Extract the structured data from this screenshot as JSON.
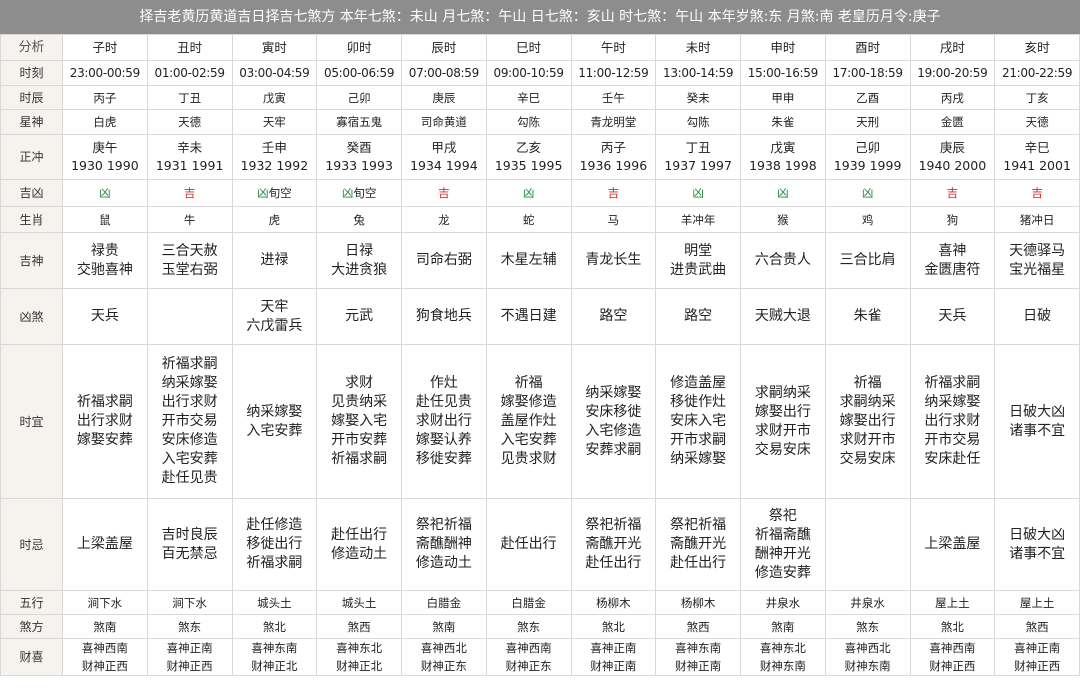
{
  "title": "择吉老黄历黄道吉日择吉七煞方   本年七煞：未山   月七煞：午山   日七煞：亥山   时七煞：午山   本年岁煞:东   月煞:南    老皇历月令:庚子",
  "colors": {
    "title_bg": "#8d8d8d",
    "label_bg": "#f6f2ee",
    "ji": "#d42a2a",
    "xiong": "#1f8a3a"
  },
  "rows": [
    {
      "key": "fenxi",
      "label": "分析",
      "h": 26,
      "cls": "",
      "cells": [
        "子时",
        "丑时",
        "寅时",
        "卯时",
        "辰时",
        "巳时",
        "午时",
        "未时",
        "申时",
        "酉时",
        "戌时",
        "亥时"
      ]
    },
    {
      "key": "shike",
      "label": "时刻",
      "h": 25,
      "cls": "t",
      "cells": [
        "23:00-00:59",
        "01:00-02:59",
        "03:00-04:59",
        "05:00-06:59",
        "07:00-08:59",
        "09:00-10:59",
        "11:00-12:59",
        "13:00-14:59",
        "15:00-16:59",
        "17:00-18:59",
        "19:00-20:59",
        "21:00-22:59"
      ]
    },
    {
      "key": "shichen",
      "label": "时辰",
      "h": 24,
      "cls": "sm",
      "cells": [
        "丙子",
        "丁丑",
        "戊寅",
        "己卯",
        "庚辰",
        "辛巳",
        "壬午",
        "癸未",
        "甲申",
        "乙酉",
        "丙戌",
        "丁亥"
      ]
    },
    {
      "key": "xingshen",
      "label": "星神",
      "h": 25,
      "cls": "sm",
      "cells": [
        "白虎",
        "天德",
        "天牢",
        "寡宿五鬼",
        "司命黄道",
        "勾陈",
        "青龙明堂",
        "勾陈",
        "朱雀",
        "天刑",
        "金匮",
        "天德"
      ]
    },
    {
      "key": "zhengchong",
      "label": "正冲",
      "h": 45,
      "cls": "",
      "cells": [
        [
          "庚午",
          "1930 1990"
        ],
        [
          "辛未",
          "1931 1991"
        ],
        [
          "壬申",
          "1932 1992"
        ],
        [
          "癸酉",
          "1933 1993"
        ],
        [
          "甲戌",
          "1934 1994"
        ],
        [
          "乙亥",
          "1935 1995"
        ],
        [
          "丙子",
          "1936 1996"
        ],
        [
          "丁丑",
          "1937 1997"
        ],
        [
          "戊寅",
          "1938 1998"
        ],
        [
          "己卯",
          "1939 1999"
        ],
        [
          "庚辰",
          "1940 2000"
        ],
        [
          "辛巳",
          "1941 2001"
        ]
      ]
    },
    {
      "key": "jixiong",
      "label": "吉凶",
      "h": 27,
      "cls": "jx",
      "cells": [
        "凶",
        "吉",
        "凶旬空",
        "凶旬空",
        "吉",
        "凶",
        "吉",
        "凶",
        "凶",
        "凶",
        "吉",
        "吉"
      ]
    },
    {
      "key": "shengxiao",
      "label": "生肖",
      "h": 26,
      "cls": "sm",
      "cells": [
        "鼠",
        "牛",
        "虎",
        "兔",
        "龙",
        "蛇",
        "马",
        "羊冲年",
        "猴",
        "鸡",
        "狗",
        "猪冲日"
      ]
    },
    {
      "key": "jishen",
      "label": "吉神",
      "h": 56,
      "cls": "big",
      "cells": [
        [
          "禄贵",
          "交驰喜神"
        ],
        [
          "三合天赦",
          "玉堂右弼"
        ],
        [
          "进禄"
        ],
        [
          "日禄",
          "大进贪狼"
        ],
        [
          "司命右弼"
        ],
        [
          "木星左辅"
        ],
        [
          "青龙长生"
        ],
        [
          "明堂",
          "进贵武曲"
        ],
        [
          "六合贵人"
        ],
        [
          "三合比肩"
        ],
        [
          "喜神",
          "金匮唐符"
        ],
        [
          "天德驿马",
          "宝光福星"
        ]
      ]
    },
    {
      "key": "xiongsha",
      "label": "凶煞",
      "h": 56,
      "cls": "big",
      "cells": [
        [
          "天兵"
        ],
        [],
        [
          "天牢",
          "六戊雷兵"
        ],
        [
          "元武"
        ],
        [
          "狗食地兵"
        ],
        [
          "不遇日建"
        ],
        [
          "路空"
        ],
        [
          "路空"
        ],
        [
          "天贼大退"
        ],
        [
          "朱雀"
        ],
        [
          "天兵"
        ],
        [
          "日破"
        ]
      ]
    },
    {
      "key": "shiyi",
      "label": "时宜",
      "h": 154,
      "cls": "big",
      "cells": [
        [
          "祈福求嗣",
          "出行求财",
          "嫁娶安葬"
        ],
        [
          "祈福求嗣",
          "纳采嫁娶",
          "出行求财",
          "开市交易",
          "安床修造",
          "入宅安葬",
          "赴任见贵"
        ],
        [
          "纳采嫁娶",
          "入宅安葬"
        ],
        [
          "求财",
          "见贵纳采",
          "嫁娶入宅",
          "开市安葬",
          "祈福求嗣"
        ],
        [
          "作灶",
          "赴任见贵",
          "求财出行",
          "嫁娶认养",
          "移徙安葬"
        ],
        [
          "祈福",
          "嫁娶修造",
          "盖屋作灶",
          "入宅安葬",
          "见贵求财"
        ],
        [
          "纳采嫁娶",
          "安床移徙",
          "入宅修造",
          "安葬求嗣"
        ],
        [
          "修造盖屋",
          "移徙作灶",
          "安床入宅",
          "开市求嗣",
          "纳采嫁娶"
        ],
        [
          "求嗣纳采",
          "嫁娶出行",
          "求财开市",
          "交易安床"
        ],
        [
          "祈福",
          "求嗣纳采",
          "嫁娶出行",
          "求财开市",
          "交易安床"
        ],
        [
          "祈福求嗣",
          "纳采嫁娶",
          "出行求财",
          "开市交易",
          "安床赴任"
        ],
        [
          "日破大凶",
          "诸事不宜"
        ]
      ]
    },
    {
      "key": "shiji",
      "label": "时忌",
      "h": 92,
      "cls": "big",
      "cells": [
        [
          "上梁盖屋"
        ],
        [
          "吉时良辰",
          "百无禁忌"
        ],
        [
          "赴任修造",
          "移徙出行",
          "祈福求嗣"
        ],
        [
          "赴任出行",
          "修造动土"
        ],
        [
          "祭祀祈福",
          "斋醮酬神",
          "修造动土"
        ],
        [
          "赴任出行"
        ],
        [
          "祭祀祈福",
          "斋醮开光",
          "赴任出行"
        ],
        [
          "祭祀祈福",
          "斋醮开光",
          "赴任出行"
        ],
        [
          "祭祀",
          "祈福斋醮",
          "酬神开光",
          "修造安葬"
        ],
        [],
        [
          "上梁盖屋"
        ],
        [
          "日破大凶",
          "诸事不宜"
        ]
      ]
    },
    {
      "key": "wuxing",
      "label": "五行",
      "h": 24,
      "cls": "sm",
      "cells": [
        "涧下水",
        "涧下水",
        "城头土",
        "城头土",
        "白腊金",
        "白腊金",
        "杨柳木",
        "杨柳木",
        "井泉水",
        "井泉水",
        "屋上土",
        "屋上土"
      ]
    },
    {
      "key": "shafang",
      "label": "煞方",
      "h": 24,
      "cls": "sm",
      "cells": [
        "煞南",
        "煞东",
        "煞北",
        "煞西",
        "煞南",
        "煞东",
        "煞北",
        "煞西",
        "煞南",
        "煞东",
        "煞北",
        "煞西"
      ]
    },
    {
      "key": "caixi",
      "label": "财喜",
      "h": 36,
      "cls": "sm",
      "cells": [
        [
          "喜神西南",
          "财神正西"
        ],
        [
          "喜神正南",
          "财神正西"
        ],
        [
          "喜神东南",
          "财神正北"
        ],
        [
          "喜神东北",
          "财神正北"
        ],
        [
          "喜神西北",
          "财神正东"
        ],
        [
          "喜神西南",
          "财神正东"
        ],
        [
          "喜神正南",
          "财神正南"
        ],
        [
          "喜神东南",
          "财神正南"
        ],
        [
          "喜神东北",
          "财神东南"
        ],
        [
          "喜神西北",
          "财神东南"
        ],
        [
          "喜神西南",
          "财神正西"
        ],
        [
          "喜神正南",
          "财神正西"
        ]
      ]
    }
  ]
}
